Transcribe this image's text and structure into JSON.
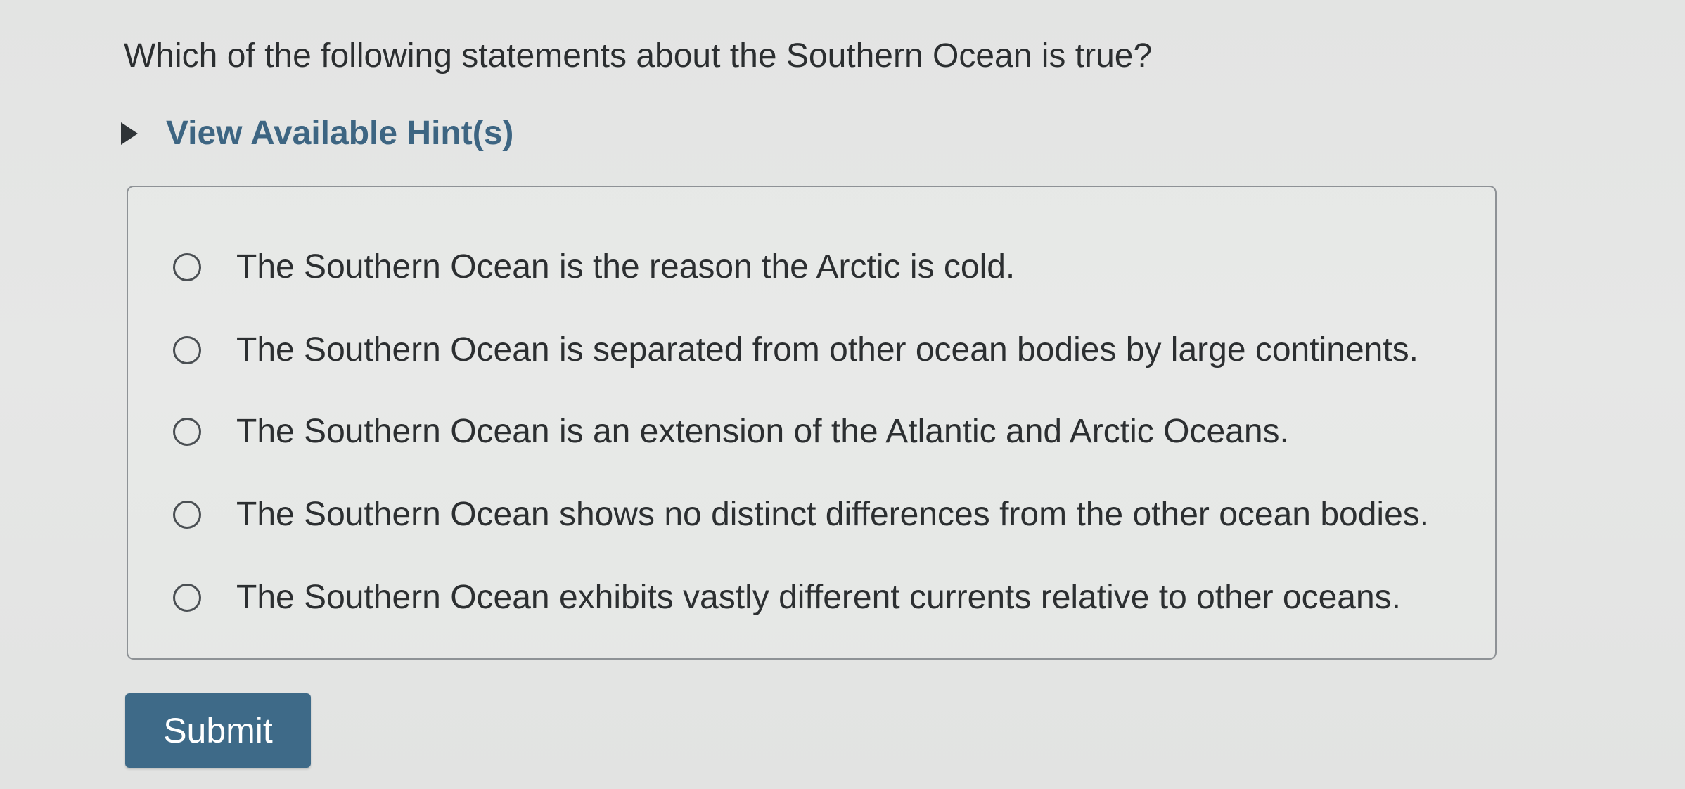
{
  "question": {
    "text": "Which of the following statements about the Southern Ocean is true?"
  },
  "hint": {
    "label": "View Available Hint(s)",
    "icon": "caret-right-icon"
  },
  "options": [
    {
      "label": "The Southern Ocean is the reason the Arctic is cold.",
      "selected": false
    },
    {
      "label": "The Southern Ocean is separated from other ocean bodies by large continents.",
      "selected": false
    },
    {
      "label": "The Southern Ocean is an extension of the Atlantic and Arctic Oceans.",
      "selected": false
    },
    {
      "label": "The Southern Ocean shows no distinct differences from the other ocean bodies.",
      "selected": false
    },
    {
      "label": "The Southern Ocean exhibits vastly different currents relative to other oceans.",
      "selected": false
    }
  ],
  "submit": {
    "label": "Submit"
  },
  "colors": {
    "accent": "#3e6a88",
    "link": "#3d6582",
    "text": "#2c2f31",
    "background": "#e5e6e5"
  }
}
